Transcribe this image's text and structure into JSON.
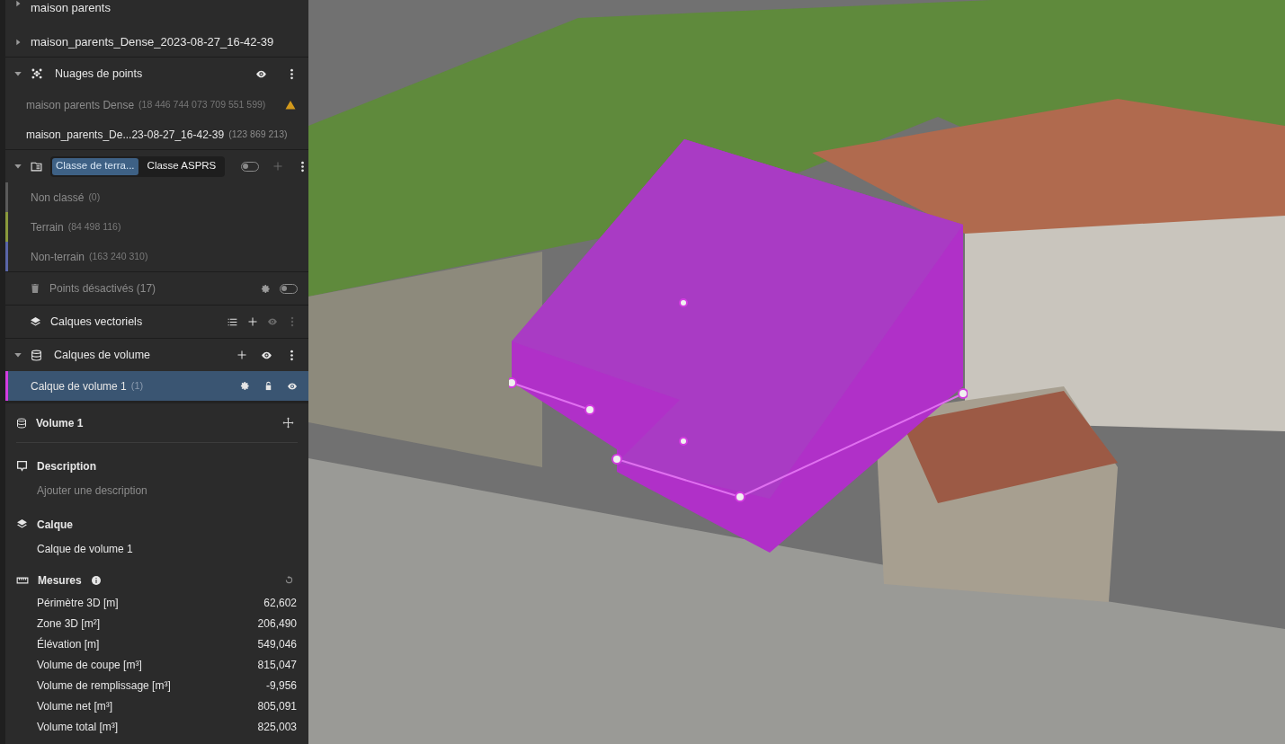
{
  "tree": [
    {
      "label": "maison parents",
      "expanded": false
    },
    {
      "label": "maison_parents_Dense_2023-08-27_16-42-39",
      "expanded": false
    }
  ],
  "point_clouds": {
    "title": "Nuages de points",
    "expanded": true,
    "items": [
      {
        "name": "maison parents Dense",
        "count": "(18 446 744 073 709 551 599)",
        "disabled": true,
        "warning": true
      },
      {
        "name": "maison_parents_De...23-08-27_16-42-39",
        "count": "(123 869 213)",
        "disabled": false,
        "warning": false
      }
    ]
  },
  "classification": {
    "expanded": true,
    "tabs": [
      {
        "label": "Classe de terra...",
        "selected": true
      },
      {
        "label": "Classe ASPRS",
        "selected": false
      }
    ],
    "toggle_on": false,
    "classes": [
      {
        "name": "Non classé",
        "count": "(0)",
        "color": "#5a5a5a"
      },
      {
        "name": "Terrain",
        "count": "(84 498 116)",
        "color": "#8a9a3c"
      },
      {
        "name": "Non-terrain",
        "count": "(163 240 310)",
        "color": "#5a66a8"
      }
    ]
  },
  "disabled_points": {
    "label": "Points désactivés (17)",
    "on": false
  },
  "vector_layers": {
    "title": "Calques vectoriels"
  },
  "volume_layers": {
    "title": "Calques de volume",
    "expanded": true,
    "items": [
      {
        "name": "Calque de volume 1",
        "count": "(1)",
        "color": "#d23ce0",
        "selected": true
      }
    ]
  },
  "details": {
    "title": "Volume 1",
    "description": {
      "heading": "Description",
      "placeholder": "Ajouter une description"
    },
    "layer": {
      "heading": "Calque",
      "value": "Calque de volume 1"
    },
    "measures": {
      "heading": "Mesures",
      "rows": [
        {
          "label": "Périmètre 3D [m]",
          "value": "62,602"
        },
        {
          "label": "Zone 3D [m²]",
          "value": "206,490"
        },
        {
          "label": "Élévation [m]",
          "value": "549,046"
        },
        {
          "label": "Volume de coupe [m³]",
          "value": "815,047"
        },
        {
          "label": "Volume de remplissage [m³]",
          "value": "-9,956"
        },
        {
          "label": "Volume net [m³]",
          "value": "805,091"
        },
        {
          "label": "Volume total [m³]",
          "value": "825,003"
        }
      ]
    }
  }
}
